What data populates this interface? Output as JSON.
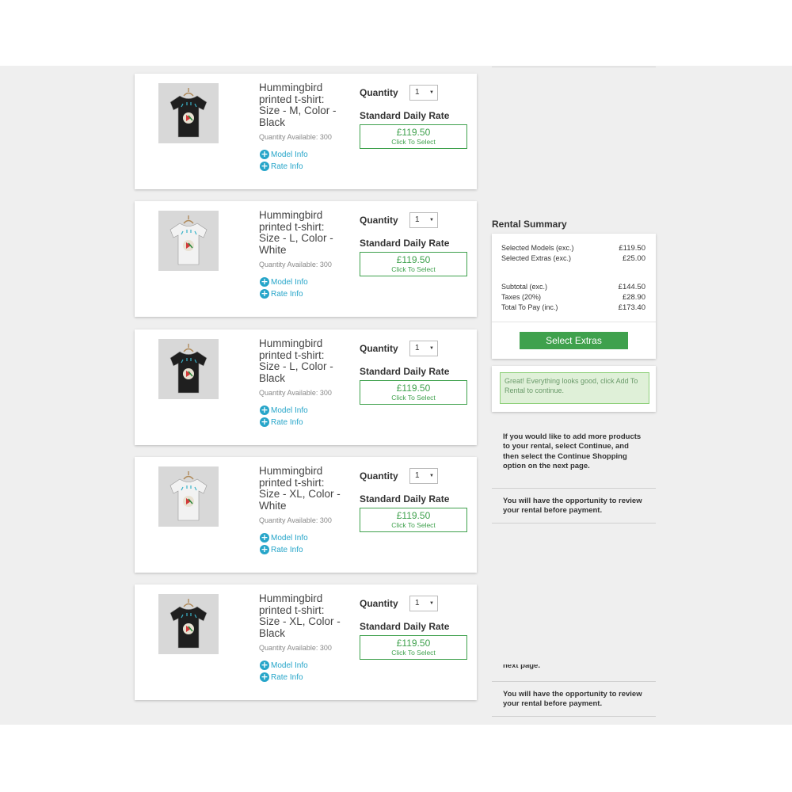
{
  "products": [
    {
      "name": "Hummingbird printed t-shirt: Size - M, Color - Black",
      "shirt_color": "#1f1f1f",
      "quantity_available": "Quantity Available: 300",
      "model_info": "Model Info",
      "rate_info": "Rate Info",
      "quantity_label": "Quantity",
      "quantity_value": "1",
      "rate_label": "Standard Daily Rate",
      "price": "£119.50",
      "price_cta": "Click To Select"
    },
    {
      "name": "Hummingbird printed t-shirt: Size - L, Color - White",
      "shirt_color": "#f2f2f2",
      "quantity_available": "Quantity Available: 300",
      "model_info": "Model Info",
      "rate_info": "Rate Info",
      "quantity_label": "Quantity",
      "quantity_value": "1",
      "rate_label": "Standard Daily Rate",
      "price": "£119.50",
      "price_cta": "Click To Select"
    },
    {
      "name": "Hummingbird printed t-shirt: Size - L, Color - Black",
      "shirt_color": "#1f1f1f",
      "quantity_available": "Quantity Available: 300",
      "model_info": "Model Info",
      "rate_info": "Rate Info",
      "quantity_label": "Quantity",
      "quantity_value": "1",
      "rate_label": "Standard Daily Rate",
      "price": "£119.50",
      "price_cta": "Click To Select"
    },
    {
      "name": "Hummingbird printed t-shirt: Size - XL, Color - White",
      "shirt_color": "#f2f2f2",
      "quantity_available": "Quantity Available: 300",
      "model_info": "Model Info",
      "rate_info": "Rate Info",
      "quantity_label": "Quantity",
      "quantity_value": "1",
      "rate_label": "Standard Daily Rate",
      "price": "£119.50",
      "price_cta": "Click To Select"
    },
    {
      "name": "Hummingbird printed t-shirt: Size - XL, Color - Black",
      "shirt_color": "#1f1f1f",
      "quantity_available": "Quantity Available: 300",
      "model_info": "Model Info",
      "rate_info": "Rate Info",
      "quantity_label": "Quantity",
      "quantity_value": "1",
      "rate_label": "Standard Daily Rate",
      "price": "£119.50",
      "price_cta": "Click To Select"
    }
  ],
  "summary": {
    "title": "Rental Summary",
    "selected_models_label": "Selected Models (exc.)",
    "selected_models_value": "£119.50",
    "selected_extras_label": "Selected Extras (exc.)",
    "selected_extras_value": "£25.00",
    "subtotal_label": "Subtotal (exc.)",
    "subtotal_value": "£144.50",
    "taxes_label": "Taxes (20%)",
    "taxes_value": "£28.90",
    "total_label": "Total To Pay (inc.)",
    "total_value": "£173.40",
    "extras_button": "Select Extras"
  },
  "alert": {
    "message": "Great! Everything looks good, click Add To Rental to continue."
  },
  "info": {
    "continue_text": "If you would like to add more products to your rental, select Continue, and then select the Continue Shopping option on the next page.",
    "review_text": "You will have the opportunity to review your rental before payment.",
    "fragment_text": "next page.",
    "review_text_repeat": "You will have the opportunity to review your rental before payment."
  },
  "colors": {
    "accent_green": "#3fa14d",
    "link_blue": "#26a5c9",
    "alert_bg": "#dff0d8"
  }
}
